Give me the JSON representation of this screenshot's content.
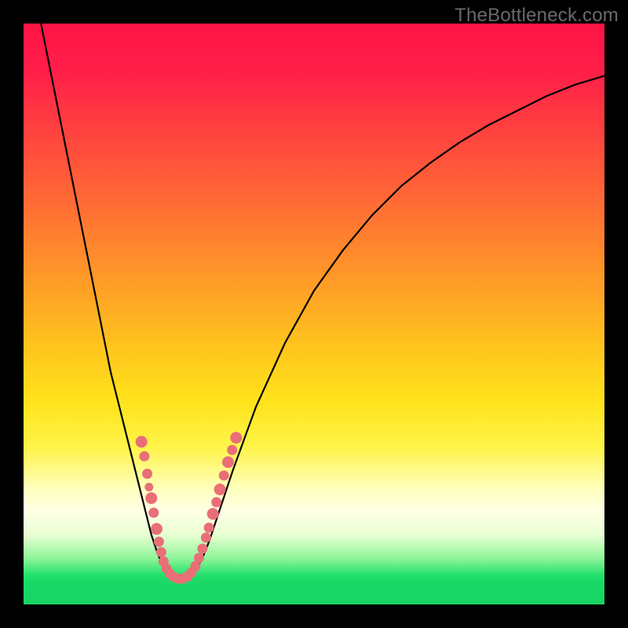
{
  "watermark": "TheBottleneck.com",
  "colors": {
    "gradient_top": "#ff1445",
    "gradient_mid": "#ffe31a",
    "gradient_green": "#18d464",
    "curve": "#000000",
    "bead": "#e96f77",
    "frame_bg": "#000000"
  },
  "chart_data": {
    "type": "line",
    "title": "",
    "xlabel": "",
    "ylabel": "",
    "xlim": [
      0,
      100
    ],
    "ylim": [
      0,
      100
    ],
    "curve_left": [
      {
        "x": 3,
        "y": 100
      },
      {
        "x": 5,
        "y": 90
      },
      {
        "x": 7,
        "y": 80
      },
      {
        "x": 9,
        "y": 70
      },
      {
        "x": 11,
        "y": 60
      },
      {
        "x": 13,
        "y": 50
      },
      {
        "x": 15,
        "y": 40
      },
      {
        "x": 17,
        "y": 32
      },
      {
        "x": 19,
        "y": 24
      },
      {
        "x": 20,
        "y": 20
      },
      {
        "x": 21,
        "y": 16
      },
      {
        "x": 22,
        "y": 12
      },
      {
        "x": 23,
        "y": 9
      },
      {
        "x": 24,
        "y": 6.5
      },
      {
        "x": 25,
        "y": 5
      },
      {
        "x": 26,
        "y": 4.5
      },
      {
        "x": 27,
        "y": 4.3
      }
    ],
    "curve_right": [
      {
        "x": 27,
        "y": 4.3
      },
      {
        "x": 28,
        "y": 4.6
      },
      {
        "x": 29,
        "y": 5.2
      },
      {
        "x": 30,
        "y": 6.5
      },
      {
        "x": 31,
        "y": 8.5
      },
      {
        "x": 32,
        "y": 11
      },
      {
        "x": 34,
        "y": 17
      },
      {
        "x": 36,
        "y": 23
      },
      {
        "x": 40,
        "y": 34
      },
      {
        "x": 45,
        "y": 45
      },
      {
        "x": 50,
        "y": 54
      },
      {
        "x": 55,
        "y": 61
      },
      {
        "x": 60,
        "y": 67
      },
      {
        "x": 65,
        "y": 72
      },
      {
        "x": 70,
        "y": 76
      },
      {
        "x": 75,
        "y": 79.5
      },
      {
        "x": 80,
        "y": 82.5
      },
      {
        "x": 85,
        "y": 85
      },
      {
        "x": 90,
        "y": 87.5
      },
      {
        "x": 95,
        "y": 89.5
      },
      {
        "x": 100,
        "y": 91
      }
    ],
    "beads": [
      {
        "x": 20.3,
        "y": 28,
        "r": 7
      },
      {
        "x": 20.8,
        "y": 25.5,
        "r": 6
      },
      {
        "x": 21.3,
        "y": 22.5,
        "r": 6
      },
      {
        "x": 21.6,
        "y": 20.2,
        "r": 5
      },
      {
        "x": 22.0,
        "y": 18.3,
        "r": 7
      },
      {
        "x": 22.4,
        "y": 15.8,
        "r": 6
      },
      {
        "x": 22.9,
        "y": 13.0,
        "r": 7
      },
      {
        "x": 23.3,
        "y": 10.8,
        "r": 6
      },
      {
        "x": 23.7,
        "y": 9.0,
        "r": 6
      },
      {
        "x": 24.1,
        "y": 7.4,
        "r": 6
      },
      {
        "x": 24.6,
        "y": 6.2,
        "r": 6
      },
      {
        "x": 25.2,
        "y": 5.3,
        "r": 6
      },
      {
        "x": 25.9,
        "y": 4.7,
        "r": 6
      },
      {
        "x": 26.6,
        "y": 4.45,
        "r": 6
      },
      {
        "x": 27.4,
        "y": 4.45,
        "r": 6
      },
      {
        "x": 28.2,
        "y": 4.8,
        "r": 6
      },
      {
        "x": 28.9,
        "y": 5.5,
        "r": 6
      },
      {
        "x": 29.6,
        "y": 6.6,
        "r": 6
      },
      {
        "x": 30.2,
        "y": 8.0,
        "r": 6
      },
      {
        "x": 30.8,
        "y": 9.6,
        "r": 6
      },
      {
        "x": 31.4,
        "y": 11.5,
        "r": 6
      },
      {
        "x": 31.9,
        "y": 13.2,
        "r": 6
      },
      {
        "x": 32.6,
        "y": 15.6,
        "r": 7
      },
      {
        "x": 33.2,
        "y": 17.6,
        "r": 6
      },
      {
        "x": 33.8,
        "y": 19.8,
        "r": 7
      },
      {
        "x": 34.5,
        "y": 22.2,
        "r": 6
      },
      {
        "x": 35.2,
        "y": 24.5,
        "r": 7
      },
      {
        "x": 35.9,
        "y": 26.6,
        "r": 6
      },
      {
        "x": 36.6,
        "y": 28.7,
        "r": 7
      }
    ]
  }
}
